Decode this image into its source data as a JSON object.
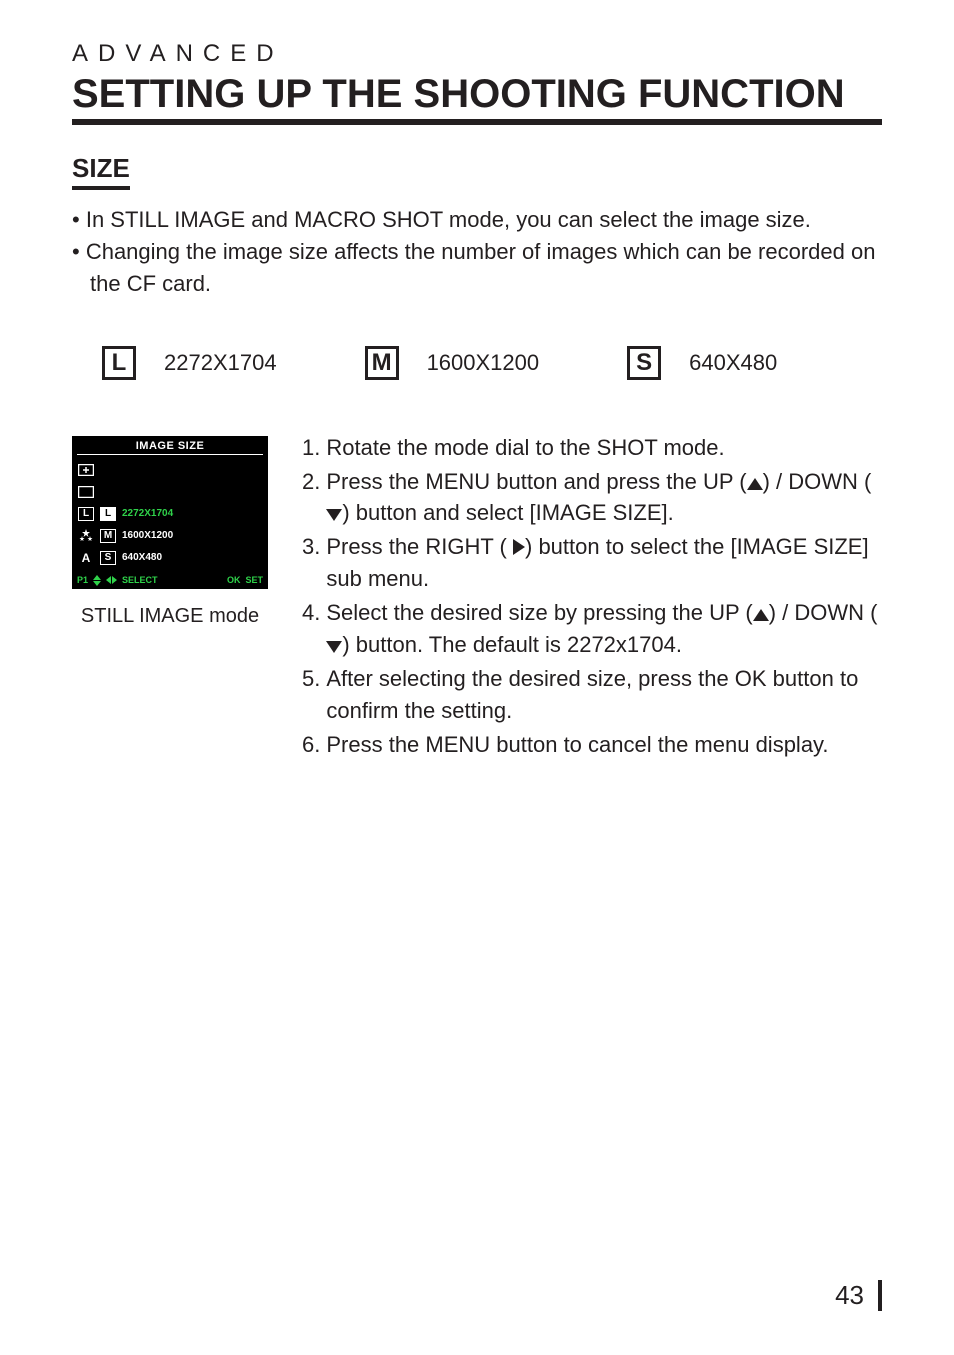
{
  "kicker": "ADVANCED",
  "title": "SETTING UP THE SHOOTING FUNCTION",
  "subhead": "SIZE",
  "bullets": [
    "In STILL IMAGE and MACRO SHOT mode, you can select the image size.",
    "Changing the image size affects the number of  images which can be recorded on the CF card."
  ],
  "sizes": [
    {
      "letter": "L",
      "dim": "2272X1704"
    },
    {
      "letter": "M",
      "dim": "1600X1200"
    },
    {
      "letter": "S",
      "dim": "640X480"
    }
  ],
  "lcd": {
    "title": "IMAGE SIZE",
    "side": {
      "row3": "L",
      "row5": "A"
    },
    "rows": [
      {
        "letter": "L",
        "val": "2272X1704",
        "highlight": true
      },
      {
        "letter": "M",
        "val": "1600X1200",
        "highlight": false
      },
      {
        "letter": "S",
        "val": "640X480",
        "highlight": false
      }
    ],
    "footer": {
      "p": "P1",
      "select": "SELECT",
      "ok": "OK",
      "set": "SET"
    },
    "caption": "STILL IMAGE mode"
  },
  "steps": {
    "s1": "Rotate the mode dial to the SHOT mode.",
    "s2a": "Press the MENU button and press the UP (",
    "s2b": ") / DOWN (",
    "s2c": ") button and select [IMAGE SIZE].",
    "s3a": "Press the RIGHT ( ",
    "s3b": ") button to select the [IMAGE SIZE] sub menu.",
    "s4a": "Select the desired size by pressing the UP (",
    "s4b": ") / DOWN (",
    "s4c": ") button. The default is 2272x1704.",
    "s5": "After selecting the desired size, press the OK button to confirm the setting.",
    "s6": "Press the MENU button to cancel the menu display."
  },
  "page_number": "43"
}
